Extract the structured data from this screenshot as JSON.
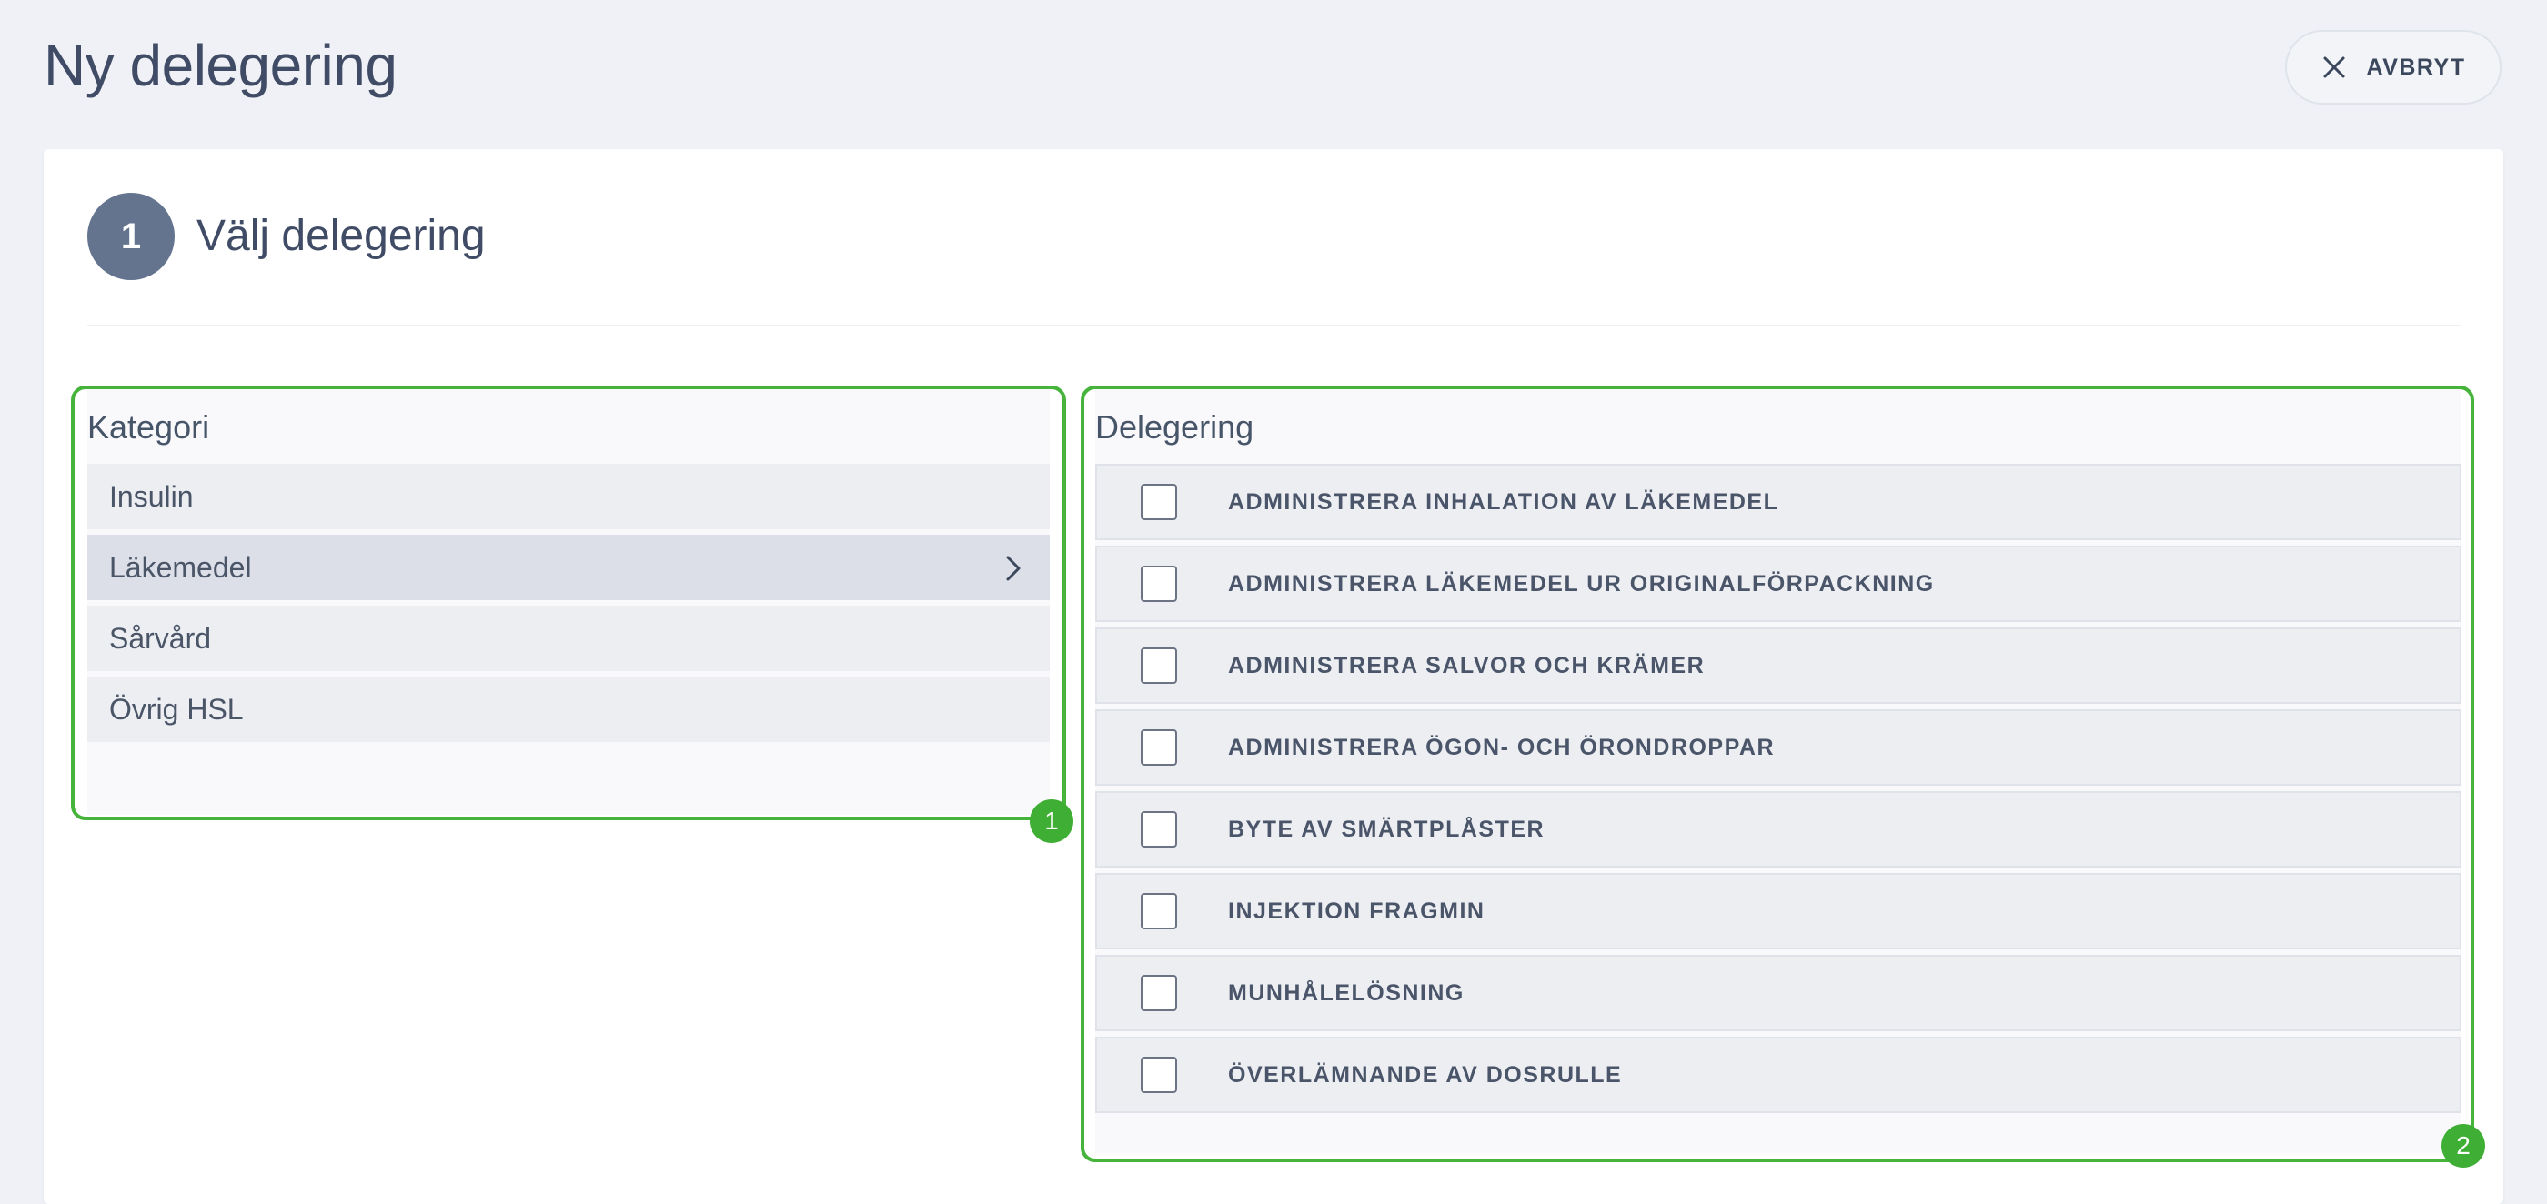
{
  "header": {
    "title": "Ny delegering",
    "cancel_label": "AVBRYT",
    "cancel_icon": "close-icon"
  },
  "step": {
    "number": "1",
    "title": "Välj delegering"
  },
  "categories": {
    "title": "Kategori",
    "items": [
      {
        "label": "Insulin",
        "selected": false
      },
      {
        "label": "Läkemedel",
        "selected": true
      },
      {
        "label": "Sårvård",
        "selected": false
      },
      {
        "label": "Övrig HSL",
        "selected": false
      }
    ]
  },
  "delegations": {
    "title": "Delegering",
    "items": [
      {
        "label": "ADMINISTRERA INHALATION AV LÄKEMEDEL",
        "checked": false
      },
      {
        "label": "ADMINISTRERA LÄKEMEDEL UR ORIGINALFÖRPACKNING",
        "checked": false
      },
      {
        "label": "ADMINISTRERA SALVOR OCH KRÄMER",
        "checked": false
      },
      {
        "label": "ADMINISTRERA ÖGON- OCH ÖRONDROPPAR",
        "checked": false
      },
      {
        "label": "BYTE AV SMÄRTPLÅSTER",
        "checked": false
      },
      {
        "label": "INJEKTION FRAGMIN",
        "checked": false
      },
      {
        "label": "MUNHÅLELÖSNING",
        "checked": false
      },
      {
        "label": "ÖVERLÄMNANDE AV DOSRULLE",
        "checked": false
      }
    ]
  },
  "annotations": {
    "marker_1": "1",
    "marker_2": "2",
    "highlight_color": "#46b43b"
  },
  "colors": {
    "background": "#eff1f6",
    "step_circle": "#64748f",
    "selected_item": "#dcdfe8"
  }
}
